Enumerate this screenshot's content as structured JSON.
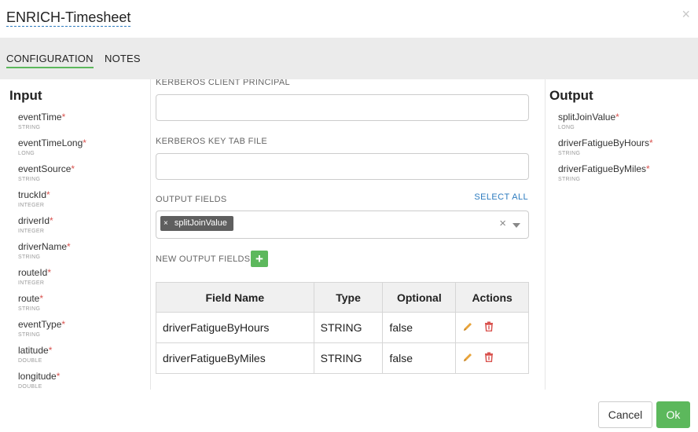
{
  "header": {
    "title": "ENRICH-Timesheet",
    "close_glyph": "×"
  },
  "tabs": [
    {
      "label": "CONFIGURATION",
      "active": true
    },
    {
      "label": "NOTES",
      "active": false
    }
  ],
  "input_panel": {
    "title": "Input",
    "fields": [
      {
        "name": "eventTime",
        "type": "STRING"
      },
      {
        "name": "eventTimeLong",
        "type": "LONG"
      },
      {
        "name": "eventSource",
        "type": "STRING"
      },
      {
        "name": "truckId",
        "type": "INTEGER"
      },
      {
        "name": "driverId",
        "type": "INTEGER"
      },
      {
        "name": "driverName",
        "type": "STRING"
      },
      {
        "name": "routeId",
        "type": "INTEGER"
      },
      {
        "name": "route",
        "type": "STRING"
      },
      {
        "name": "eventType",
        "type": "STRING"
      },
      {
        "name": "latitude",
        "type": "DOUBLE"
      },
      {
        "name": "longitude",
        "type": "DOUBLE"
      }
    ]
  },
  "output_panel": {
    "title": "Output",
    "fields": [
      {
        "name": "splitJoinValue",
        "type": "LONG"
      },
      {
        "name": "driverFatigueByHours",
        "type": "STRING"
      },
      {
        "name": "driverFatigueByMiles",
        "type": "STRING"
      }
    ]
  },
  "form": {
    "kerberos_principal_label": "KERBEROS CLIENT PRINCIPAL",
    "kerberos_principal_value": "",
    "kerberos_keytab_label": "KERBEROS KEY TAB FILE",
    "kerberos_keytab_value": "",
    "output_fields_label": "OUTPUT FIELDS",
    "select_all_label": "SELECT ALL",
    "output_fields_selected": [
      "splitJoinValue"
    ],
    "new_output_fields_label": "NEW OUTPUT FIELDS"
  },
  "table": {
    "headers": [
      "Field Name",
      "Type",
      "Optional",
      "Actions"
    ],
    "rows": [
      {
        "field_name": "driverFatigueByHours",
        "type": "STRING",
        "optional": "false"
      },
      {
        "field_name": "driverFatigueByMiles",
        "type": "STRING",
        "optional": "false"
      }
    ]
  },
  "footer": {
    "cancel_label": "Cancel",
    "ok_label": "Ok"
  },
  "colors": {
    "accent_green": "#5cb85c",
    "required_red": "#d9534f",
    "link_blue": "#2c7bbf",
    "edit_orange": "#e8a33a",
    "delete_red": "#d9534f"
  }
}
